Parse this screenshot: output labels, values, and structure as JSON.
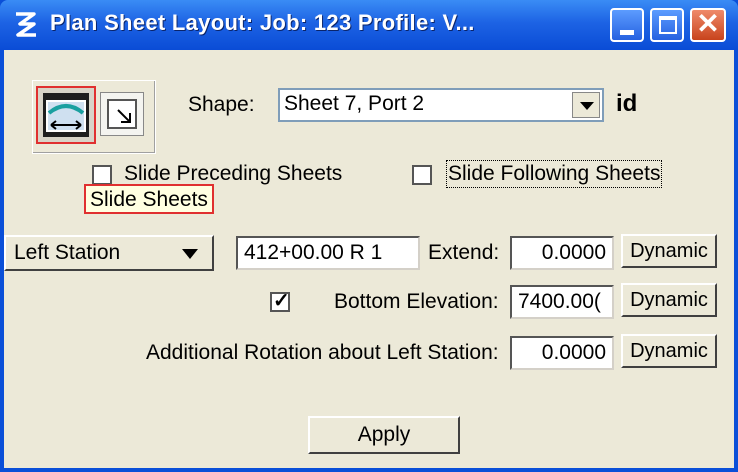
{
  "window": {
    "title": "Plan Sheet Layout:   Job: 123   Profile: V...",
    "icon": "app-logo-icon",
    "controls": [
      "minimize-icon",
      "maximize-icon",
      "close-icon"
    ]
  },
  "shape": {
    "label": "Shape:",
    "value": "Sheet 7, Port 2",
    "id_label": "id"
  },
  "options": {
    "slide_preceding": {
      "label": "Slide Preceding Sheets",
      "checked": false
    },
    "slide_following": {
      "label": "Slide Following Sheets",
      "checked": false
    }
  },
  "tooltip": "Slide Sheets",
  "station": {
    "dropdown_value": "Left Station",
    "value": "412+00.00 R 1",
    "extend_label": "Extend:",
    "extend_value": "0.0000",
    "dynamic_label": "Dynamic"
  },
  "elevation": {
    "checked": true,
    "label": "Bottom Elevation:",
    "value": "7400.00(",
    "dynamic_label": "Dynamic"
  },
  "rotation": {
    "label": "Additional Rotation about Left Station:",
    "value": "0.0000",
    "dynamic_label": "Dynamic"
  },
  "apply_label": "Apply"
}
